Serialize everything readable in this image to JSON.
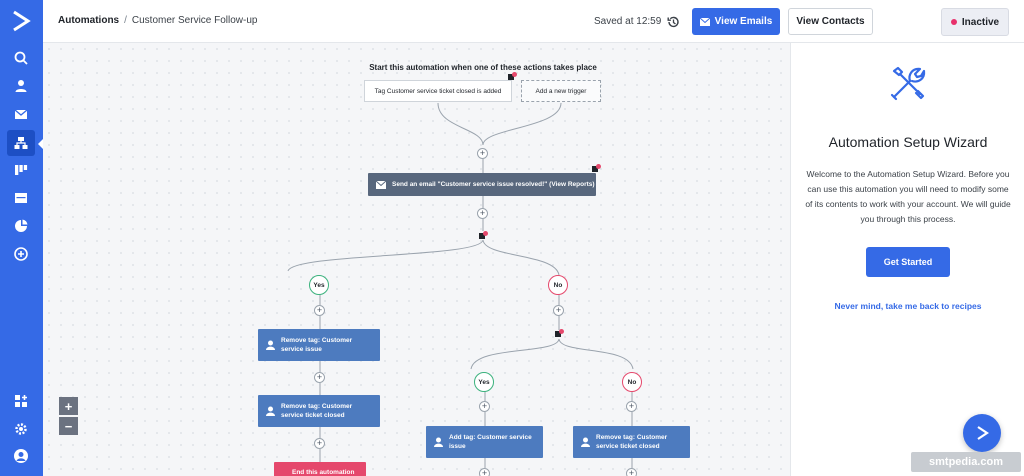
{
  "header": {
    "breadcrumb_root": "Automations",
    "breadcrumb_separator": "/",
    "breadcrumb_current": "Customer Service Follow-up",
    "saved_text": "Saved at 12:59",
    "view_emails_label": "View Emails",
    "view_contacts_label": "View Contacts",
    "status_label": "Inactive"
  },
  "sidebar": {
    "items": [
      "search-icon",
      "contacts-icon",
      "email-icon",
      "automations-icon",
      "deals-icon",
      "site-icon",
      "reports-icon",
      "add-icon",
      "apps-icon",
      "settings-icon",
      "account-icon"
    ],
    "active": "automations-icon"
  },
  "canvas": {
    "start_label": "Start this automation when one of these actions takes place",
    "trigger_label": "Tag Customer service ticket closed is added",
    "add_trigger_label": "Add a new trigger",
    "send_email_label": "Send an email \"Customer service issue resolved!\" (View Reports)",
    "yes_label": "Yes",
    "no_label": "No",
    "remove_tag_1": "Remove tag: Customer service issue",
    "remove_tag_2": "Remove tag: Customer service ticket closed",
    "end_label": "End this automation",
    "yes2_label": "Yes",
    "no2_label": "No",
    "add_tag_label": "Add tag: Customer service issue",
    "remove_tag_3": "Remove tag: Customer service ticket closed",
    "zoom_in": "+",
    "zoom_out": "−"
  },
  "panel": {
    "title": "Automation Setup Wizard",
    "description": "Welcome to the Automation Setup Wizard. Before you can use this automation you will need to modify some of its contents to work with your account. We will guide you through this process.",
    "get_started_label": "Get Started",
    "back_link": "Never mind, take me back to recipes"
  },
  "watermark": "smtpedia.com",
  "colors": {
    "brand_blue": "#356ae6",
    "action_gray": "#58677d",
    "action_blue": "#4d7bbf",
    "end_red": "#e5486c",
    "yes_green": "#3bb27d",
    "status_dot": "#e8306b"
  }
}
